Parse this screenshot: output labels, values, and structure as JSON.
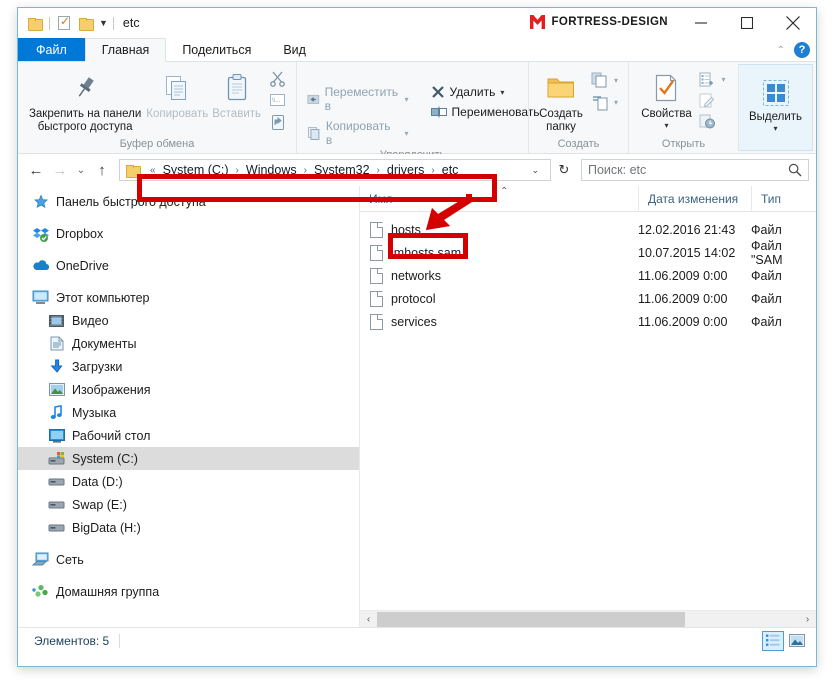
{
  "window": {
    "title": "etc",
    "brand": "FORTRESS-DESIGN",
    "quick_access": [
      {
        "name": "folder-icon",
        "label": "Свойства папки"
      },
      {
        "name": "properties-icon",
        "label": "Свойства"
      },
      {
        "name": "new-folder-icon",
        "label": "Создать папку"
      },
      {
        "name": "customize-caret-icon",
        "label": "▼"
      }
    ],
    "controls": {
      "minimize": "—",
      "maximize": "□",
      "close": "✕"
    }
  },
  "ribbon": {
    "tabs": [
      {
        "id": "file",
        "label": "Файл"
      },
      {
        "id": "home",
        "label": "Главная"
      },
      {
        "id": "share",
        "label": "Поделиться"
      },
      {
        "id": "view",
        "label": "Вид"
      }
    ],
    "active_tab": "Главная",
    "collapse_caret": "⌃",
    "help_label": "?",
    "groups": [
      {
        "id": "clipboard",
        "label": "Буфер обмена",
        "pin": {
          "label": "Закрепить на панели\nбыстрого доступа",
          "line1": "Закрепить на панели",
          "line2": "быстрого доступа"
        },
        "copy": "Копировать",
        "paste": "Вставить",
        "cut": "Вырезать",
        "copy_path": "Копировать путь",
        "paste_shortcut": "Вставить ярлык"
      },
      {
        "id": "organize",
        "label": "Упорядочить",
        "move_to": "Переместить в",
        "copy_to": "Копировать в",
        "delete": "Удалить",
        "rename": "Переименовать"
      },
      {
        "id": "new",
        "label": "Создать",
        "new_folder_line1": "Создать",
        "new_folder_line2": "папку",
        "new_item": "Создать элемент",
        "easy_access": "Простой доступ"
      },
      {
        "id": "open",
        "label": "Открыть",
        "properties": "Свойства",
        "open_with": "Открыть",
        "edit": "Изменить",
        "history": "Журнал"
      },
      {
        "id": "select",
        "label": "",
        "select": "Выделить"
      }
    ]
  },
  "address_bar": {
    "back_icon": "←",
    "forward_icon": "→",
    "recent_caret": "⌄",
    "up_icon": "↑",
    "crumb_prefix": "«",
    "crumbs": [
      "System (C:)",
      "Windows",
      "System32",
      "drivers",
      "etc"
    ],
    "crumb_separator": "›",
    "dropdown_caret": "⌄",
    "refresh_icon": "↻"
  },
  "search": {
    "placeholder": "Поиск: etc",
    "icon": "search-icon"
  },
  "sidebar": {
    "items": [
      {
        "label": "Панель быстрого доступа",
        "icon": "pin-star-icon",
        "indent": false,
        "selected": false
      },
      {
        "gap": true
      },
      {
        "label": "Dropbox",
        "icon": "dropbox-icon",
        "indent": false,
        "selected": false
      },
      {
        "gap": true
      },
      {
        "label": "OneDrive",
        "icon": "onedrive-cloud-icon",
        "indent": false,
        "selected": false
      },
      {
        "gap": true
      },
      {
        "label": "Этот компьютер",
        "icon": "this-pc-icon",
        "indent": false,
        "selected": false
      },
      {
        "label": "Видео",
        "icon": "video-folder-icon",
        "indent": true,
        "selected": false
      },
      {
        "label": "Документы",
        "icon": "documents-folder-icon",
        "indent": true,
        "selected": false
      },
      {
        "label": "Загрузки",
        "icon": "downloads-folder-icon",
        "indent": true,
        "selected": false
      },
      {
        "label": "Изображения",
        "icon": "pictures-folder-icon",
        "indent": true,
        "selected": false
      },
      {
        "label": "Музыка",
        "icon": "music-folder-icon",
        "indent": true,
        "selected": false
      },
      {
        "label": "Рабочий стол",
        "icon": "desktop-folder-icon",
        "indent": true,
        "selected": false
      },
      {
        "label": "System (C:)",
        "icon": "system-drive-icon",
        "indent": true,
        "selected": true
      },
      {
        "label": "Data (D:)",
        "icon": "drive-icon",
        "indent": true,
        "selected": false
      },
      {
        "label": "Swap (E:)",
        "icon": "drive-icon",
        "indent": true,
        "selected": false
      },
      {
        "label": "BigData (H:)",
        "icon": "drive-icon",
        "indent": true,
        "selected": false
      },
      {
        "gap": true
      },
      {
        "label": "Сеть",
        "icon": "network-icon",
        "indent": false,
        "selected": false
      },
      {
        "gap": true
      },
      {
        "label": "Домашняя группа",
        "icon": "homegroup-icon",
        "indent": false,
        "selected": false
      }
    ]
  },
  "file_list": {
    "columns": [
      {
        "key": "name",
        "label": "Имя",
        "sorted": true,
        "sort_indicator": "⌃"
      },
      {
        "key": "date",
        "label": "Дата изменения"
      },
      {
        "key": "type",
        "label": "Тип"
      }
    ],
    "rows": [
      {
        "name": "hosts",
        "date": "12.02.2016 21:43",
        "type": "Файл",
        "icon": "file-icon",
        "highlighted": true
      },
      {
        "name": "lmhosts.sam",
        "date": "10.07.2015 14:02",
        "type": "Файл \"SAM",
        "icon": "file-icon",
        "highlighted": false
      },
      {
        "name": "networks",
        "date": "11.06.2009 0:00",
        "type": "Файл",
        "icon": "file-icon",
        "highlighted": false
      },
      {
        "name": "protocol",
        "date": "11.06.2009 0:00",
        "type": "Файл",
        "icon": "file-icon",
        "highlighted": false
      },
      {
        "name": "services",
        "date": "11.06.2009 0:00",
        "type": "Файл",
        "icon": "file-icon",
        "highlighted": false
      }
    ],
    "hscroll": {
      "left_arrow": "‹",
      "right_arrow": "›"
    }
  },
  "status_bar": {
    "item_count_text": "Элементов: 5",
    "views": [
      {
        "name": "details-view-button",
        "active": true
      },
      {
        "name": "large-icons-view-button",
        "active": false
      }
    ]
  },
  "annotations": {
    "accent_color": "#d40000",
    "address_box": "highlight around breadcrumb path",
    "hosts_box": "highlight around hosts file",
    "arrow": "red arrow pointing from address bar to hosts file"
  }
}
